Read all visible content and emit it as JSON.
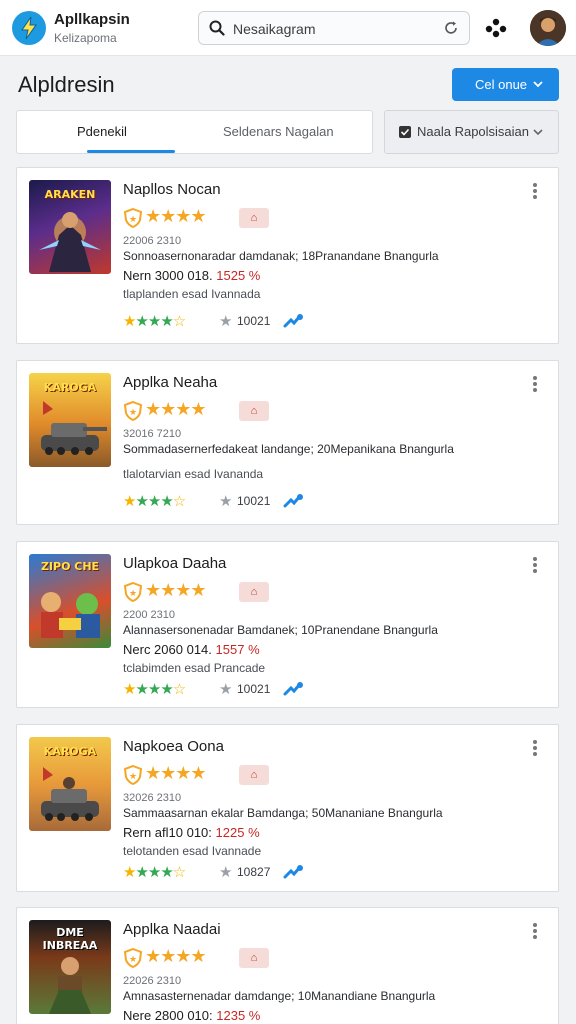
{
  "app": {
    "name": "Apllkapsin",
    "subtitle": "Kelizapoma"
  },
  "search": {
    "value": "Nesaikagram"
  },
  "page": {
    "title": "Alpldresin",
    "primary_button": "Cel onue"
  },
  "tabs": [
    {
      "label": "Pdenekil",
      "active": true
    },
    {
      "label": "Seldenars Nagalan",
      "active": false
    }
  ],
  "filter": {
    "label": "Naala Rapolsisaian",
    "checked": true
  },
  "colors": {
    "accent": "#1e88e5",
    "star": "#f5a623",
    "price_percent": "#c62828"
  },
  "cards": [
    {
      "title": "Napllos Nocan",
      "thumb_text": "ARAKEN",
      "version": "22006 2310",
      "description": "Sonnoasernonaradar damdanak; 18Pranandane Bnangurla",
      "price": "Nern 3000 018.",
      "percent": "1525 %",
      "subtext": "tlaplanden esad Ivannada",
      "count": "10021"
    },
    {
      "title": "Applka Neaha",
      "thumb_text": "KAROGA",
      "version": "32016 7210",
      "description": "Sommadasernerfedakeat landange; 20Mepanikana Bnangurla",
      "price": "",
      "percent": "",
      "subtext": "tlalotarvian esad Ivananda",
      "count": "10021"
    },
    {
      "title": "Ulapkoa Daaha",
      "thumb_text": "ZIPO CHE",
      "version": "2200 2310",
      "description": "Alannasersonenadar Bamdanek; 10Pranendane Bnangurla",
      "price": "Nerc 2060 014.",
      "percent": "1557 %",
      "subtext": "tclabimden esad Prancade",
      "count": "10021"
    },
    {
      "title": "Napkoea Oona",
      "thumb_text": "KAROGA",
      "version": "32026 2310",
      "description": "Sammaasarnan ekalar Bamdanga; 50Mananiane Bnangurla",
      "price": "Rern afl10 010:",
      "percent": "1225 %",
      "subtext": "telotanden esad Ivannade",
      "count": "10827"
    },
    {
      "title": "Applka Naadai",
      "thumb_text": "DME INBREAA",
      "version": "22026 2310",
      "description": "Amnasasternenadar damdange; 10Manandiane Bnangurla",
      "price": "Nere 2800 010:",
      "percent": "1235 %",
      "subtext": "",
      "count": ""
    }
  ]
}
